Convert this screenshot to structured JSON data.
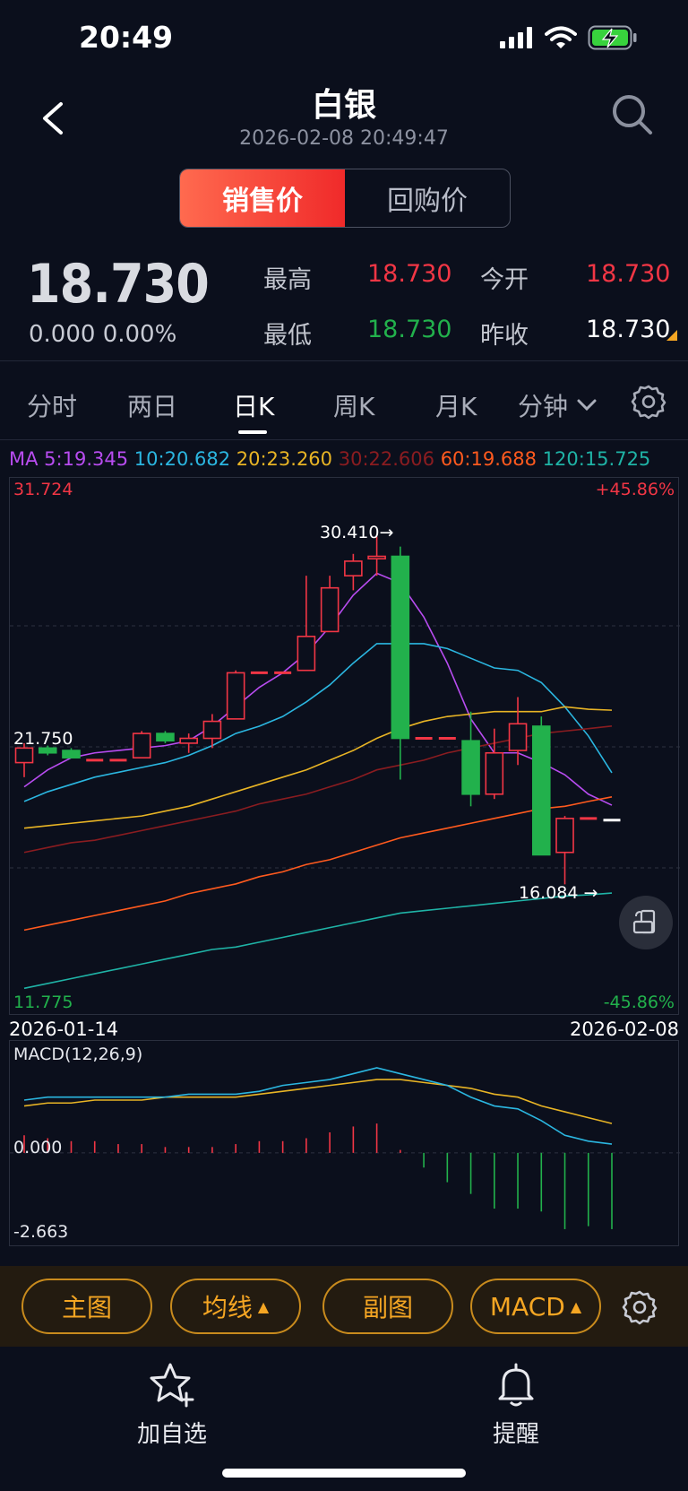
{
  "status": {
    "time": "20:49"
  },
  "nav": {
    "title": "白银",
    "subtitle": "2026-02-08 20:49:47",
    "back_icon": "chevron-left-icon",
    "search_icon": "search-icon"
  },
  "segment": {
    "active": "销售价",
    "inactive": "回购价"
  },
  "quote": {
    "price": "18.730",
    "change": "0.000",
    "change_pct": "0.00%",
    "high_label": "最高",
    "high": "18.730",
    "open_label": "今开",
    "open": "18.730",
    "low_label": "最低",
    "low": "18.730",
    "prev_label": "昨收",
    "prev": "18.730",
    "colors": {
      "up": "#f23645",
      "down": "#22b14c",
      "neutral": "#e6e8ee"
    }
  },
  "tabs": {
    "items": [
      "分时",
      "两日",
      "日K",
      "周K",
      "月K",
      "分钟"
    ],
    "active": "日K",
    "settings_icon": "gear-icon"
  },
  "ma": {
    "label": "MA",
    "items": [
      {
        "text": "5:19.345",
        "color": "#b84cf0"
      },
      {
        "text": "10:20.682",
        "color": "#2bb6e0"
      },
      {
        "text": "20:23.260",
        "color": "#e8b425"
      },
      {
        "text": "30:22.606",
        "color": "#8a1c20"
      },
      {
        "text": "60:19.688",
        "color": "#ff5a1e"
      },
      {
        "text": "120:15.725",
        "color": "#1fb3a6"
      }
    ]
  },
  "chart_data": [
    {
      "type": "candlestick",
      "title": "",
      "y_max_label": "31.724",
      "y_min_label": "11.775",
      "y_mid_label": "21.750",
      "pct_top": "+45.86%",
      "pct_bottom": "-45.86%",
      "x_start": "2026-01-14",
      "x_end": "2026-02-08",
      "ylim": [
        11.775,
        31.724
      ],
      "annotation_high": "30.410→",
      "annotation_low": "16.084 →",
      "candles": [
        {
          "o": 21.1,
          "h": 21.9,
          "l": 20.5,
          "c": 21.7
        },
        {
          "o": 21.7,
          "h": 21.8,
          "l": 21.4,
          "c": 21.5
        },
        {
          "o": 21.6,
          "h": 21.7,
          "l": 21.3,
          "c": 21.3
        },
        {
          "o": 21.2,
          "h": 21.2,
          "l": 21.2,
          "c": 21.2
        },
        {
          "o": 21.2,
          "h": 21.2,
          "l": 21.2,
          "c": 21.2
        },
        {
          "o": 21.3,
          "h": 22.4,
          "l": 21.3,
          "c": 22.3
        },
        {
          "o": 22.3,
          "h": 22.4,
          "l": 21.9,
          "c": 22.0
        },
        {
          "o": 21.9,
          "h": 22.3,
          "l": 21.5,
          "c": 22.1
        },
        {
          "o": 22.1,
          "h": 23.1,
          "l": 21.7,
          "c": 22.8
        },
        {
          "o": 22.9,
          "h": 24.9,
          "l": 22.9,
          "c": 24.8
        },
        {
          "o": 24.8,
          "h": 24.8,
          "l": 24.8,
          "c": 24.8
        },
        {
          "o": 24.8,
          "h": 24.8,
          "l": 24.8,
          "c": 24.8
        },
        {
          "o": 24.9,
          "h": 28.8,
          "l": 24.9,
          "c": 26.3
        },
        {
          "o": 26.5,
          "h": 28.8,
          "l": 26.5,
          "c": 28.3
        },
        {
          "o": 28.8,
          "h": 29.7,
          "l": 28.2,
          "c": 29.4
        },
        {
          "o": 29.5,
          "h": 30.41,
          "l": 28.8,
          "c": 29.6
        },
        {
          "o": 29.6,
          "h": 30.0,
          "l": 20.4,
          "c": 22.1
        },
        {
          "o": 22.1,
          "h": 22.1,
          "l": 22.1,
          "c": 22.1
        },
        {
          "o": 22.1,
          "h": 22.1,
          "l": 22.1,
          "c": 22.1
        },
        {
          "o": 22.0,
          "h": 23.2,
          "l": 19.3,
          "c": 19.8
        },
        {
          "o": 19.8,
          "h": 22.5,
          "l": 19.6,
          "c": 21.5
        },
        {
          "o": 21.6,
          "h": 23.8,
          "l": 21.0,
          "c": 22.7
        },
        {
          "o": 22.6,
          "h": 23.0,
          "l": 17.3,
          "c": 17.3
        },
        {
          "o": 17.4,
          "h": 18.9,
          "l": 16.084,
          "c": 18.8
        },
        {
          "o": 18.8,
          "h": 18.8,
          "l": 18.8,
          "c": 18.8
        },
        {
          "o": 18.73,
          "h": 18.73,
          "l": 18.73,
          "c": 18.73
        }
      ],
      "ma_lines": {
        "ma5": [
          20.1,
          20.8,
          21.3,
          21.5,
          21.6,
          21.7,
          21.8,
          22.0,
          22.6,
          23.4,
          24.2,
          24.8,
          25.6,
          26.7,
          28.0,
          28.9,
          28.5,
          27.1,
          25.2,
          22.9,
          21.5,
          21.5,
          21.1,
          20.6,
          19.8,
          19.345
        ],
        "ma10": [
          19.5,
          19.9,
          20.2,
          20.5,
          20.7,
          20.9,
          21.1,
          21.4,
          21.8,
          22.3,
          22.6,
          23.0,
          23.6,
          24.3,
          25.2,
          26.0,
          26.0,
          26.0,
          25.8,
          25.4,
          25.0,
          24.9,
          24.4,
          23.4,
          22.2,
          20.682
        ],
        "ma20": [
          18.4,
          18.5,
          18.6,
          18.7,
          18.8,
          18.9,
          19.1,
          19.3,
          19.6,
          19.9,
          20.2,
          20.5,
          20.8,
          21.2,
          21.6,
          22.1,
          22.5,
          22.8,
          23.0,
          23.1,
          23.2,
          23.2,
          23.2,
          23.4,
          23.3,
          23.26
        ],
        "ma30": [
          17.4,
          17.6,
          17.8,
          17.9,
          18.1,
          18.3,
          18.5,
          18.7,
          18.9,
          19.1,
          19.4,
          19.6,
          19.8,
          20.1,
          20.4,
          20.8,
          21.0,
          21.2,
          21.5,
          21.7,
          21.9,
          22.1,
          22.3,
          22.4,
          22.5,
          22.606
        ],
        "ma60": [
          14.2,
          14.4,
          14.6,
          14.8,
          15.0,
          15.2,
          15.4,
          15.7,
          15.9,
          16.1,
          16.4,
          16.6,
          16.9,
          17.1,
          17.4,
          17.7,
          18.0,
          18.2,
          18.4,
          18.6,
          18.8,
          19.0,
          19.2,
          19.3,
          19.5,
          19.688
        ],
        "ma120": [
          11.8,
          12.0,
          12.2,
          12.4,
          12.6,
          12.8,
          13.0,
          13.2,
          13.4,
          13.5,
          13.7,
          13.9,
          14.1,
          14.3,
          14.5,
          14.7,
          14.9,
          15.0,
          15.1,
          15.2,
          15.3,
          15.4,
          15.5,
          15.6,
          15.65,
          15.725
        ]
      }
    },
    {
      "type": "macd",
      "title": "MACD(12,26,9)",
      "zero_label": "0.000",
      "min_label": "-2.663",
      "ylim": [
        -2.663,
        2.9
      ],
      "dif": [
        1.8,
        1.9,
        1.9,
        1.9,
        1.9,
        1.9,
        1.9,
        2.0,
        2.0,
        2.0,
        2.1,
        2.3,
        2.4,
        2.5,
        2.7,
        2.9,
        2.7,
        2.5,
        2.3,
        1.9,
        1.6,
        1.5,
        1.1,
        0.6,
        0.4,
        0.3
      ],
      "dea": [
        1.6,
        1.7,
        1.7,
        1.8,
        1.8,
        1.8,
        1.9,
        1.9,
        1.9,
        1.9,
        2.0,
        2.1,
        2.2,
        2.3,
        2.4,
        2.5,
        2.5,
        2.4,
        2.3,
        2.2,
        2.0,
        1.9,
        1.6,
        1.4,
        1.2,
        1.0
      ],
      "hist": [
        0.6,
        0.5,
        0.4,
        0.4,
        0.3,
        0.3,
        0.2,
        0.2,
        0.2,
        0.3,
        0.4,
        0.4,
        0.5,
        0.7,
        0.9,
        1.0,
        0.1,
        -0.5,
        -1.0,
        -1.4,
        -1.9,
        -1.9,
        -2.0,
        -2.6,
        -2.5,
        -2.6
      ]
    }
  ],
  "bottom_bar": {
    "items": [
      "主图",
      "均线",
      "副图",
      "MACD"
    ],
    "caret": "▲",
    "settings_icon": "gear-icon"
  },
  "footer": {
    "watchlist": "加自选",
    "alert": "提醒"
  }
}
